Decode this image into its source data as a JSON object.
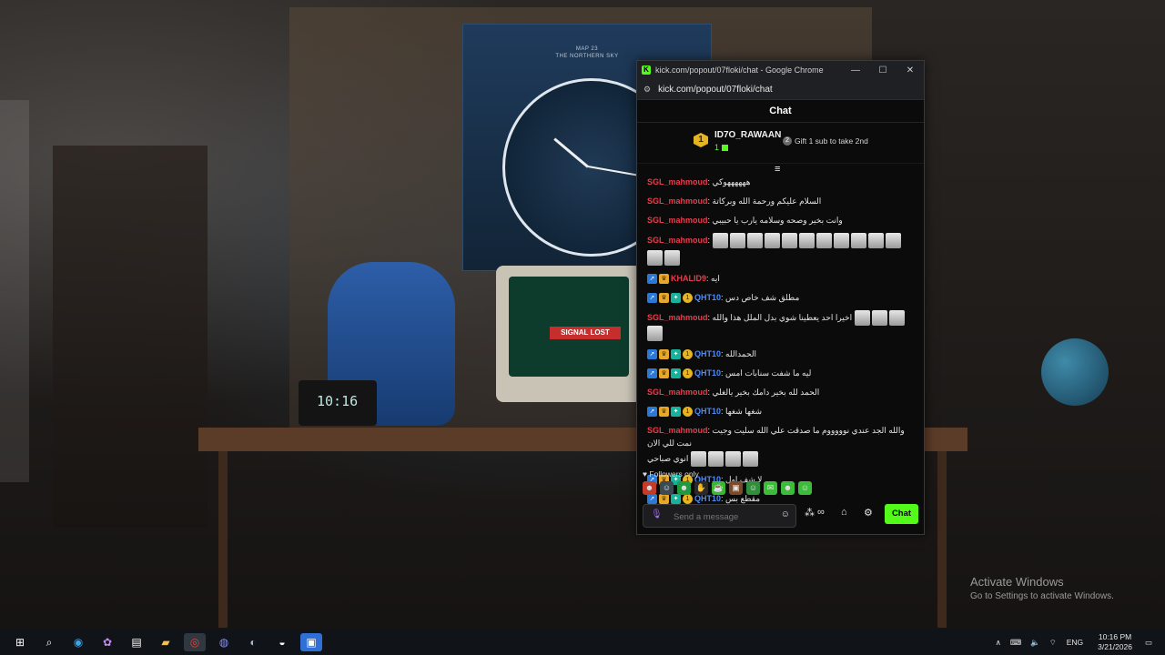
{
  "desktop": {
    "poster_line1": "MAP 23",
    "poster_line2": "THE NORTHERN SKY",
    "clock_device": "10:16",
    "signal_label": "SIGNAL LOST",
    "activate_title": "Activate Windows",
    "activate_sub": "Go to Settings to activate Windows."
  },
  "window": {
    "title": "kick.com/popout/07floki/chat - Google Chrome",
    "url": "kick.com/popout/07floki/chat",
    "minimize": "—",
    "maximize": "☐",
    "close": "✕"
  },
  "chat": {
    "header": "Chat",
    "top_gifter": {
      "rank": "1",
      "name": "ID7O_RAWAAN",
      "count": "1"
    },
    "second": {
      "rank": "2",
      "text": "Gift 1 sub to take 2nd"
    },
    "messages": [
      {
        "user": "SGL_mahmoud",
        "text": "ههههههوكي"
      },
      {
        "user": "SGL_mahmoud",
        "text": "السلام عليكم ورحمة الله وبركاتة"
      },
      {
        "user": "SGL_mahmoud",
        "text": "وانت بخير وصحه وسلامه يارب يا حبيبي"
      },
      {
        "user": "SGL_mahmoud",
        "text": ""
      },
      {
        "user": "KHALID9",
        "text": "ايه"
      },
      {
        "user": "QHT10",
        "text": "مطلق شف خاص دس"
      },
      {
        "user": "SGL_mahmoud",
        "text": "اخيرا احد يعطينا شوي بدل الملل هذا والله"
      },
      {
        "user": "QHT10",
        "text": "الحمدالله"
      },
      {
        "user": "QHT10",
        "text": "ليه ما شفت سنابات امس"
      },
      {
        "user": "SGL_mahmoud",
        "text": "الحمد لله بخير دامك بخير يالغلي"
      },
      {
        "user": "QHT10",
        "text": "شغها شغها"
      },
      {
        "user": "SGL_mahmoud",
        "text": "والله الجد عندي نوووووم ما صدقت علي الله سليت وجيت نمت للي الان",
        "text2": "انوي صباحي"
      },
      {
        "user": "QHT10",
        "text": "لا شف اول"
      },
      {
        "user": "QHT10",
        "text": "مقطع بس"
      }
    ],
    "followers_only": "Followers only",
    "input_placeholder": "Send a message",
    "send_label": "Chat"
  },
  "taskbar": {
    "lang": "ENG",
    "time": "10:16 PM",
    "date": "3/21/2026"
  },
  "colors": {
    "accent": "#53fc18",
    "user_red": "#ea3b4a",
    "user_blue": "#4d8bf5"
  }
}
